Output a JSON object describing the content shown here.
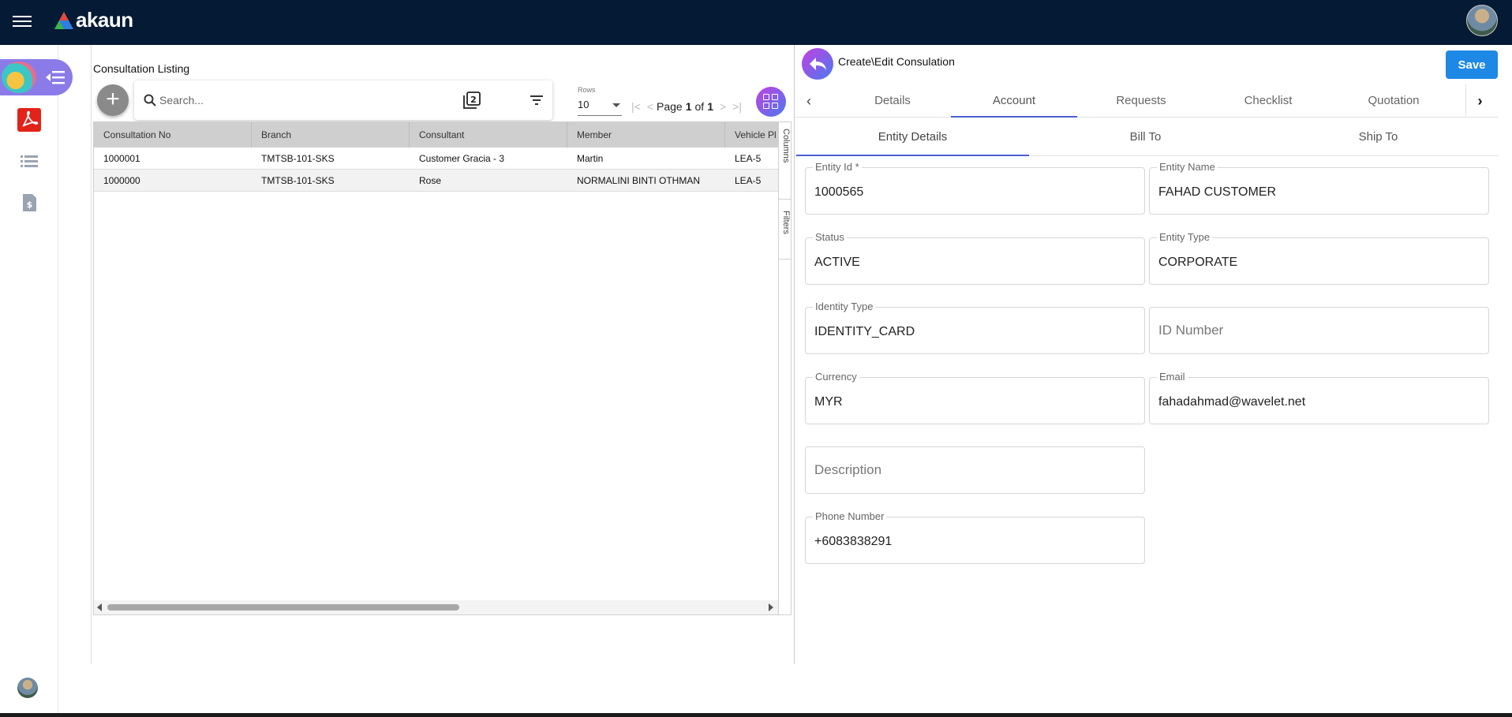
{
  "app": {
    "logo_text": "akaun"
  },
  "listing": {
    "title": "Consultation Listing",
    "search_placeholder": "Search...",
    "multi_count": "2",
    "rows_label": "Rows",
    "rows_value": "10",
    "page_label": "Page",
    "page_current": "1",
    "page_of": "of",
    "page_total": "1",
    "columns": [
      "Consultation No",
      "Branch",
      "Consultant",
      "Member",
      "Vehicle Pl"
    ],
    "rows": [
      [
        "1000001",
        "TMTSB-101-SKS",
        "Customer Gracia - 3",
        "Martin",
        "LEA-5"
      ],
      [
        "1000000",
        "TMTSB-101-SKS",
        "Rose",
        "NORMALINI BINTI OTHMAN",
        "LEA-5"
      ]
    ],
    "side_tabs": [
      "Columns",
      "Filters"
    ]
  },
  "editor": {
    "title": "Create\\Edit Consulation",
    "save_label": "Save",
    "tabs": [
      "Details",
      "Account",
      "Requests",
      "Checklist",
      "Quotation"
    ],
    "active_tab": "Account",
    "subtabs": [
      "Entity Details",
      "Bill To",
      "Ship To"
    ],
    "fields": {
      "entity_id": {
        "label": "Entity Id *",
        "value": "1000565"
      },
      "entity_name": {
        "label": "Entity Name",
        "value": "FAHAD CUSTOMER"
      },
      "status": {
        "label": "Status",
        "value": "ACTIVE"
      },
      "entity_type": {
        "label": "Entity Type",
        "value": "CORPORATE"
      },
      "identity_type": {
        "label": "Identity Type",
        "value": "IDENTITY_CARD"
      },
      "id_number": {
        "placeholder": "ID Number"
      },
      "currency": {
        "label": "Currency",
        "value": "MYR"
      },
      "email": {
        "label": "Email",
        "value": "fahadahmad@wavelet.net"
      },
      "description": {
        "placeholder": "Description"
      },
      "phone": {
        "label": "Phone Number",
        "value": "+6083838291"
      }
    }
  },
  "colors": {
    "topbar": "#051a35",
    "accent": "#1e88e5",
    "tab_indicator": "#4a5fd0",
    "rail_highlight": "#8b7be8"
  }
}
